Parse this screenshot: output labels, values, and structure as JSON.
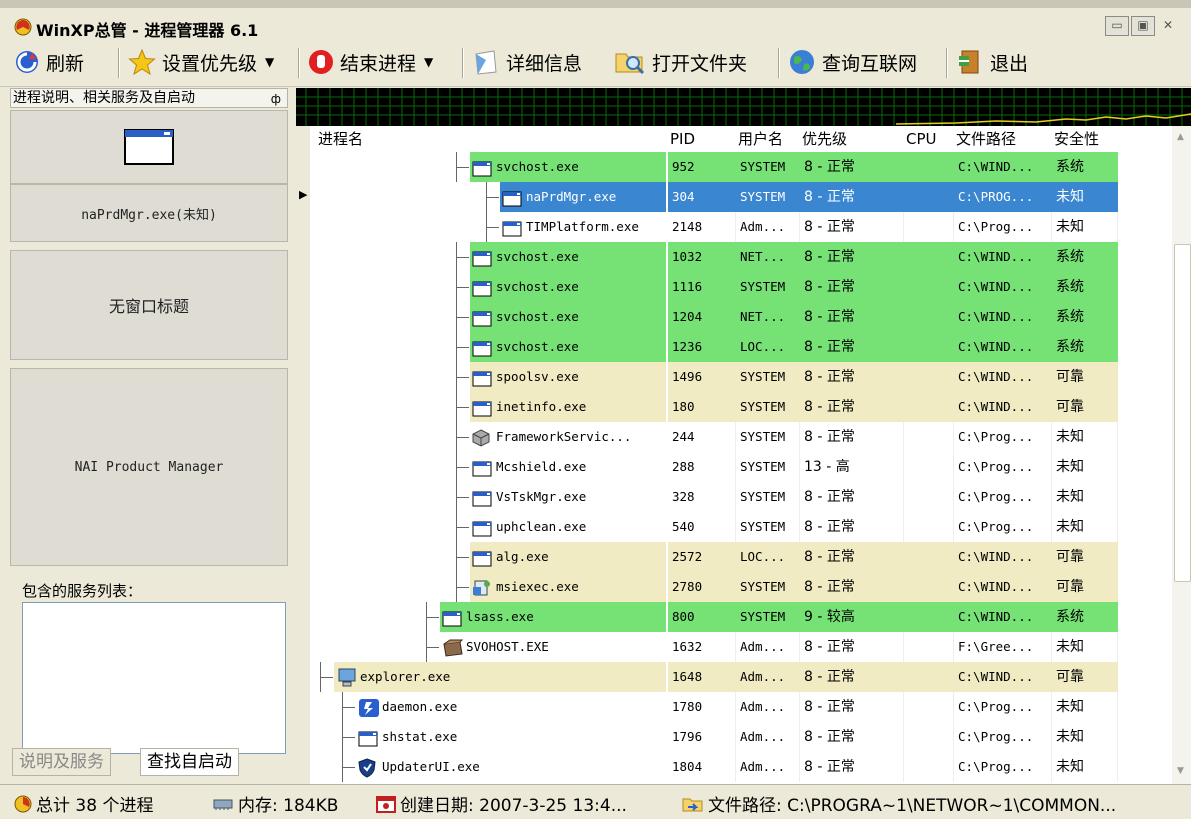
{
  "window": {
    "title": "WinXP总管 - 进程管理器 6.1"
  },
  "toolbar": {
    "refresh": "刷新",
    "set_priority": "设置优先级",
    "end_process": "结束进程",
    "details": "详细信息",
    "open_folder": "打开文件夹",
    "query_internet": "查询互联网",
    "exit": "退出"
  },
  "left_panel": {
    "header": "进程说明、相关服务及自启动",
    "pin": "ф",
    "process_name": "naPrdMgr.exe(未知)",
    "window_title": "无窗口标题",
    "description": "NAI Product Manager",
    "services_label": "包含的服务列表：",
    "tabs": [
      "说明及服务",
      "查找自启动"
    ]
  },
  "table": {
    "columns": [
      "进程名",
      "PID",
      "用户名",
      "优先级",
      "CPU",
      "文件路径",
      "安全性"
    ],
    "rows": [
      {
        "name": "svchost.exe",
        "pid": "952",
        "user": "SYSTEM",
        "priority": "8 - 正常",
        "cpu": "",
        "path": "C:\\WIND...",
        "security": "系统",
        "color": "green",
        "indent": 1,
        "icon": "window"
      },
      {
        "name": "naPrdMgr.exe",
        "pid": "304",
        "user": "SYSTEM",
        "priority": "8 - 正常",
        "cpu": "",
        "path": "C:\\PROG...",
        "security": "未知",
        "color": "selected",
        "indent": 2,
        "icon": "window"
      },
      {
        "name": "TIMPlatform.exe",
        "pid": "2148",
        "user": "Adm...",
        "priority": "8 - 正常",
        "cpu": "",
        "path": "C:\\Prog...",
        "security": "未知",
        "color": "white",
        "indent": 2,
        "icon": "window"
      },
      {
        "name": "svchost.exe",
        "pid": "1032",
        "user": "NET...",
        "priority": "8 - 正常",
        "cpu": "",
        "path": "C:\\WIND...",
        "security": "系统",
        "color": "green",
        "indent": 1,
        "icon": "window"
      },
      {
        "name": "svchost.exe",
        "pid": "1116",
        "user": "SYSTEM",
        "priority": "8 - 正常",
        "cpu": "",
        "path": "C:\\WIND...",
        "security": "系统",
        "color": "green",
        "indent": 1,
        "icon": "window"
      },
      {
        "name": "svchost.exe",
        "pid": "1204",
        "user": "NET...",
        "priority": "8 - 正常",
        "cpu": "",
        "path": "C:\\WIND...",
        "security": "系统",
        "color": "green",
        "indent": 1,
        "icon": "window"
      },
      {
        "name": "svchost.exe",
        "pid": "1236",
        "user": "LOC...",
        "priority": "8 - 正常",
        "cpu": "",
        "path": "C:\\WIND...",
        "security": "系统",
        "color": "green",
        "indent": 1,
        "icon": "window"
      },
      {
        "name": "spoolsv.exe",
        "pid": "1496",
        "user": "SYSTEM",
        "priority": "8 - 正常",
        "cpu": "",
        "path": "C:\\WIND...",
        "security": "可靠",
        "color": "tan",
        "indent": 1,
        "icon": "window"
      },
      {
        "name": "inetinfo.exe",
        "pid": "180",
        "user": "SYSTEM",
        "priority": "8 - 正常",
        "cpu": "",
        "path": "C:\\WIND...",
        "security": "可靠",
        "color": "tan",
        "indent": 1,
        "icon": "window"
      },
      {
        "name": "FrameworkServic...",
        "pid": "244",
        "user": "SYSTEM",
        "priority": "8 - 正常",
        "cpu": "",
        "path": "C:\\Prog...",
        "security": "未知",
        "color": "white",
        "indent": 1,
        "icon": "cube"
      },
      {
        "name": "Mcshield.exe",
        "pid": "288",
        "user": "SYSTEM",
        "priority": "13 - 高",
        "cpu": "",
        "path": "C:\\Prog...",
        "security": "未知",
        "color": "white",
        "indent": 1,
        "icon": "window"
      },
      {
        "name": "VsTskMgr.exe",
        "pid": "328",
        "user": "SYSTEM",
        "priority": "8 - 正常",
        "cpu": "",
        "path": "C:\\Prog...",
        "security": "未知",
        "color": "white",
        "indent": 1,
        "icon": "window"
      },
      {
        "name": "uphclean.exe",
        "pid": "540",
        "user": "SYSTEM",
        "priority": "8 - 正常",
        "cpu": "",
        "path": "C:\\Prog...",
        "security": "未知",
        "color": "white",
        "indent": 1,
        "icon": "window"
      },
      {
        "name": "alg.exe",
        "pid": "2572",
        "user": "LOC...",
        "priority": "8 - 正常",
        "cpu": "",
        "path": "C:\\WIND...",
        "security": "可靠",
        "color": "tan",
        "indent": 1,
        "icon": "window"
      },
      {
        "name": "msiexec.exe",
        "pid": "2780",
        "user": "SYSTEM",
        "priority": "8 - 正常",
        "cpu": "",
        "path": "C:\\WIND...",
        "security": "可靠",
        "color": "tan",
        "indent": 1,
        "icon": "installer"
      },
      {
        "name": "lsass.exe",
        "pid": "800",
        "user": "SYSTEM",
        "priority": "9 - 较高",
        "cpu": "",
        "path": "C:\\WIND...",
        "security": "系统",
        "color": "green",
        "indent": 0,
        "icon": "window"
      },
      {
        "name": "SVOHOST.EXE",
        "pid": "1632",
        "user": "Adm...",
        "priority": "8 - 正常",
        "cpu": "",
        "path": "F:\\Gree...",
        "security": "未知",
        "color": "white",
        "indent": 0,
        "icon": "box"
      },
      {
        "name": "explorer.exe",
        "pid": "1648",
        "user": "Adm...",
        "priority": "8 - 正常",
        "cpu": "",
        "path": "C:\\WIND...",
        "security": "可靠",
        "color": "tan",
        "indent": -1,
        "icon": "computer"
      },
      {
        "name": "daemon.exe",
        "pid": "1780",
        "user": "Adm...",
        "priority": "8 - 正常",
        "cpu": "",
        "path": "C:\\Prog...",
        "security": "未知",
        "color": "white",
        "indent": -0.6,
        "icon": "daemon"
      },
      {
        "name": "shstat.exe",
        "pid": "1796",
        "user": "Adm...",
        "priority": "8 - 正常",
        "cpu": "",
        "path": "C:\\Prog...",
        "security": "未知",
        "color": "white",
        "indent": -0.6,
        "icon": "window"
      },
      {
        "name": "UpdaterUI.exe",
        "pid": "1804",
        "user": "Adm...",
        "priority": "8 - 正常",
        "cpu": "",
        "path": "C:\\Prog...",
        "security": "未知",
        "color": "white",
        "indent": -0.6,
        "icon": "shield"
      }
    ]
  },
  "status": {
    "total": "总计 38 个进程",
    "memory": "内存: 184KB",
    "created": "创建日期: 2007-3-25 13:4...",
    "filepath": "文件路径: C:\\PROGRA~1\\NETWOR~1\\COMMON..."
  },
  "colors": {
    "green": "#76e276",
    "tan": "#f0ebc2",
    "selected": "#3a86d0",
    "white": "#ffffff"
  }
}
